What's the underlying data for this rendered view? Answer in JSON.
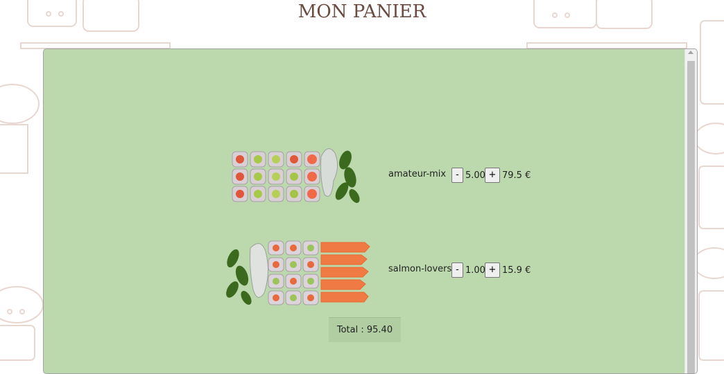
{
  "header": {
    "title": "MON PANIER"
  },
  "cart": {
    "items": [
      {
        "name": "amateur-mix",
        "minus": "-",
        "quantity": "5.00",
        "plus": "+",
        "price": "79.5 €"
      },
      {
        "name": "salmon-lovers",
        "minus": "-",
        "quantity": "1.00",
        "plus": "+",
        "price": "15.9 €"
      }
    ],
    "total_label": "Total : 95.40"
  },
  "colors": {
    "panel_bg": "#bcd8ad",
    "title": "#6b4a42",
    "doodle": "#e7d6d0"
  }
}
